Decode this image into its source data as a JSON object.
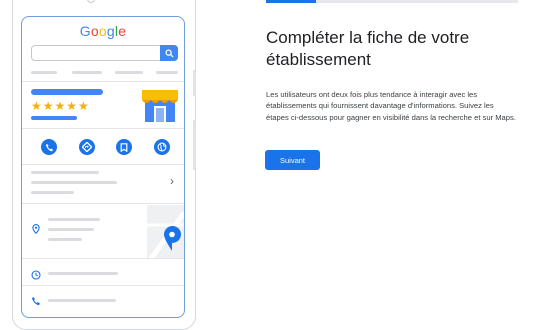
{
  "preview": {
    "logo_letters": [
      {
        "ch": "G",
        "color": "#4285F4"
      },
      {
        "ch": "o",
        "color": "#EA4335"
      },
      {
        "ch": "o",
        "color": "#FBBC05"
      },
      {
        "ch": "g",
        "color": "#4285F4"
      },
      {
        "ch": "l",
        "color": "#34A853"
      },
      {
        "ch": "e",
        "color": "#EA4335"
      }
    ],
    "rating_stars": "★★★★★",
    "chevron": "›",
    "action_icons": [
      "phone-icon",
      "directions-icon",
      "bookmark-icon",
      "website-icon"
    ]
  },
  "content": {
    "title": "Compléter la fiche de votre établissement",
    "description": "Les utilisateurs ont deux fois plus tendance à interagir avec les établissements qui fournissent davantage d'informations. Suivez les étapes ci-dessous pour gagner en visibilité dans la recherche et sur Maps.",
    "next_button": "Suivant",
    "progress_fraction": 0.2
  },
  "colors": {
    "accent": "#1a73e8",
    "google_blue": "#4285F4",
    "star": "#f2b300"
  }
}
